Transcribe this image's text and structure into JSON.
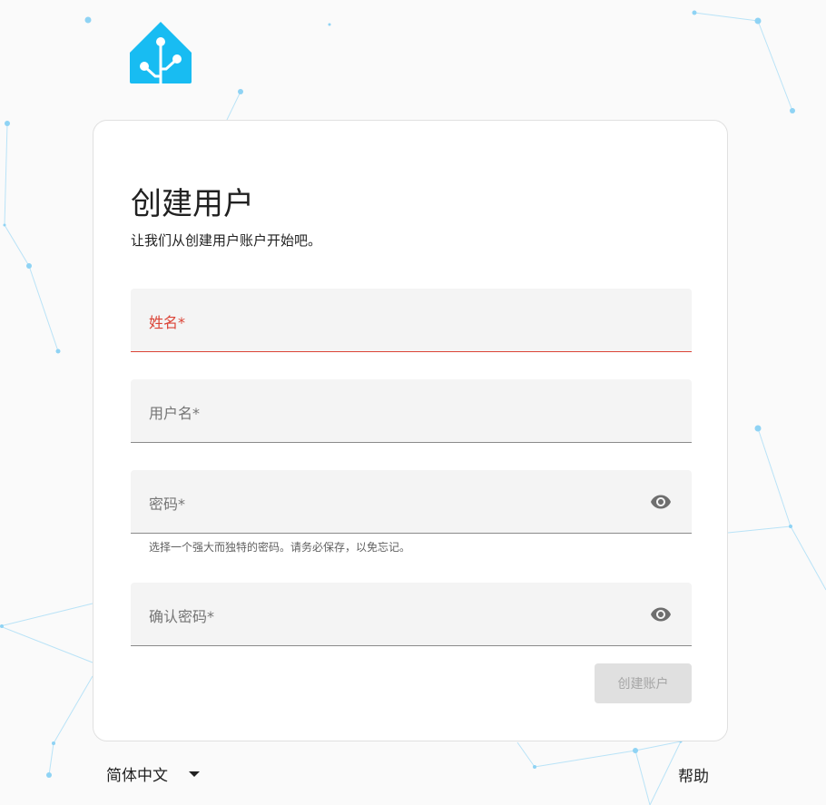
{
  "app": {
    "logo": "home-assistant-logo-icon",
    "brand_color": "#18bcf2"
  },
  "card": {
    "title": "创建用户",
    "subtitle": "让我们从创建用户账户开始吧。",
    "fields": {
      "name": {
        "label": "姓名*",
        "state": "invalid"
      },
      "username": {
        "label": "用户名*"
      },
      "password": {
        "label": "密码*",
        "helper": "选择一个强大而独特的密码。请务必保存，以免忘记。",
        "icon": "eye-icon"
      },
      "confirm": {
        "label": "确认密码*",
        "icon": "eye-icon"
      }
    },
    "submit_label": "创建账户",
    "submit_state": "disabled"
  },
  "footer": {
    "language": "简体中文",
    "language_icon": "caret-down-icon",
    "help": "帮助"
  },
  "colors": {
    "error": "#db4437",
    "field_bg": "#f4f4f4",
    "network": "#8fd3f4"
  }
}
